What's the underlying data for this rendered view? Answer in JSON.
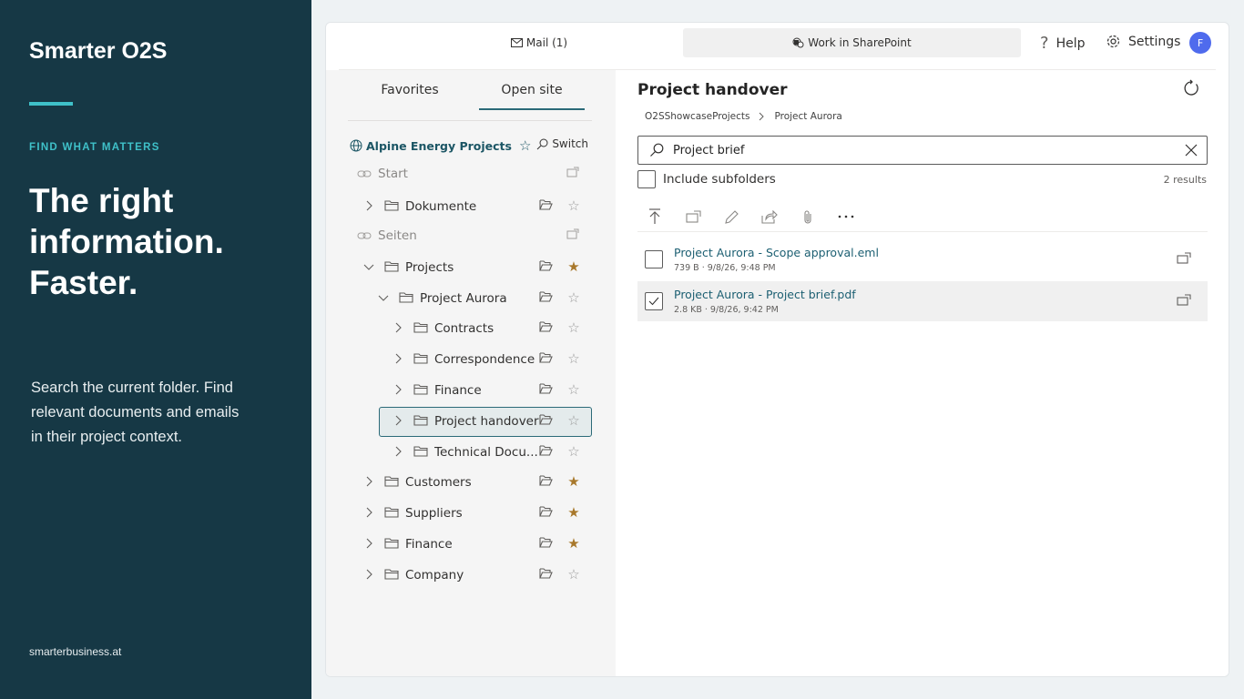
{
  "promo": {
    "brand": "Smarter O2S",
    "kicker": "FIND WHAT MATTERS",
    "headline": "The right information. Faster.",
    "copy": "Search the current folder. Find relevant documents and emails in their project context.",
    "site": "smarterbusiness.at",
    "accent_color": "#3fc1c9",
    "bg_color": "#163845"
  },
  "topbar": {
    "mail_label": "Mail (1)",
    "sharepoint_label": "Work in SharePoint",
    "help_label": "Help",
    "settings_label": "Settings",
    "avatar_initial": "F"
  },
  "sidebar": {
    "tabs": [
      "Favorites",
      "Open site"
    ],
    "active_tab": "Open site",
    "site_name": "Alpine Energy Projects",
    "switch_label": "Switch",
    "items": [
      {
        "label": "Start",
        "type": "link",
        "starred": null
      },
      {
        "label": "Dokumente",
        "type": "folder",
        "starred": false
      },
      {
        "label": "Seiten",
        "type": "link",
        "starred": null
      },
      {
        "label": "Projects",
        "type": "folder",
        "starred": true
      },
      {
        "label": "Project Aurora",
        "type": "folder",
        "starred": false
      },
      {
        "label": "Contracts",
        "type": "folder",
        "starred": false
      },
      {
        "label": "Correspondence",
        "type": "folder",
        "starred": false
      },
      {
        "label": "Finance",
        "type": "folder",
        "starred": false
      },
      {
        "label": "Project handover",
        "type": "folder",
        "starred": false,
        "selected": true
      },
      {
        "label": "Technical Docu...",
        "type": "folder",
        "starred": false
      },
      {
        "label": "Customers",
        "type": "folder",
        "starred": true
      },
      {
        "label": "Suppliers",
        "type": "folder",
        "starred": true
      },
      {
        "label": "Finance",
        "type": "folder",
        "starred": true
      },
      {
        "label": "Company",
        "type": "folder",
        "starred": false
      }
    ]
  },
  "main": {
    "title": "Project handover",
    "breadcrumb": [
      "O2SShowcaseProjects",
      "Project Aurora"
    ],
    "search_value": "Project brief",
    "include_subfolders_label": "Include subfolders",
    "results_label": "2 results",
    "files": [
      {
        "name": "Project Aurora - Scope approval.eml",
        "meta": "739 B · 9/8/26, 9:48 PM",
        "checked": false
      },
      {
        "name": "Project Aurora - Project brief.pdf",
        "meta": "2.8 KB · 9/8/26, 9:42 PM",
        "checked": true
      }
    ],
    "toolbar_icons": [
      "upload-icon",
      "open-external-icon",
      "edit-icon",
      "share-icon",
      "attach-icon",
      "more-icon"
    ]
  },
  "colors": {
    "accent": "#2b6a78",
    "star_on": "#a8782b",
    "link": "#1c5f72",
    "avatar": "#4f6bed"
  }
}
